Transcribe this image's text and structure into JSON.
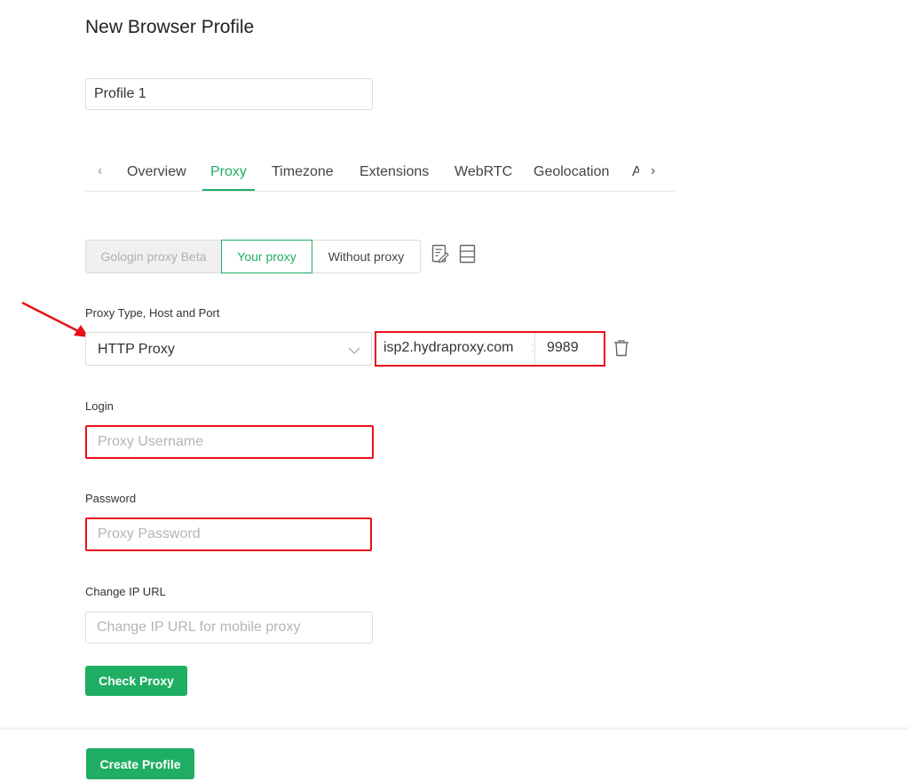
{
  "page": {
    "title": "New Browser Profile"
  },
  "profile_name": {
    "value": "Profile 1"
  },
  "tabs": {
    "items": [
      {
        "label": "Overview"
      },
      {
        "label": "Proxy"
      },
      {
        "label": "Timezone"
      },
      {
        "label": "Extensions"
      },
      {
        "label": "WebRTC"
      },
      {
        "label": "Geolocation"
      }
    ],
    "clipped_label": "Advanced",
    "active": "Proxy",
    "prev_glyph": "‹",
    "next_glyph": "›"
  },
  "proxy_mode": {
    "gologin_label": "Gologin proxy Beta",
    "your_label": "Your proxy",
    "without_label": "Without proxy"
  },
  "proxy": {
    "type_label": "Proxy Type, Host and Port",
    "type_value": "HTTP Proxy",
    "host": "isp2.hydraproxy.com",
    "separator": ":",
    "port": "9989",
    "login_label": "Login",
    "login_placeholder": "Proxy Username",
    "password_label": "Password",
    "password_placeholder": "Proxy Password",
    "change_ip_label": "Change IP URL",
    "change_ip_placeholder": "Change IP URL for mobile proxy"
  },
  "buttons": {
    "check_proxy": "Check Proxy",
    "create_profile": "Create Profile"
  },
  "colors": {
    "accent": "#1fae63",
    "highlight": "#e8101a"
  },
  "icons": [
    "edit-icon",
    "list-icon",
    "trash-icon",
    "chevron-down-icon",
    "annotation-arrow"
  ]
}
